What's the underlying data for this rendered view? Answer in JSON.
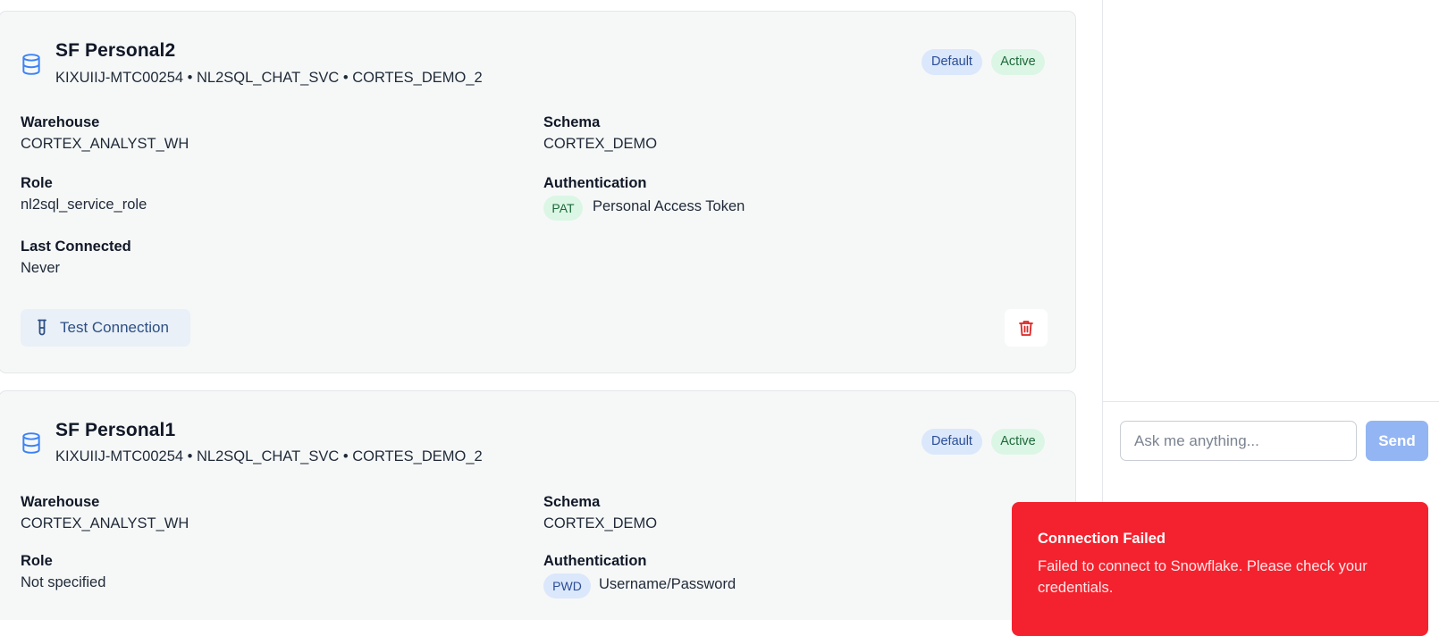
{
  "connections": [
    {
      "name": "SF Personal2",
      "subtitle": "KIXUIIJ-MTC00254 • NL2SQL_CHAT_SVC • CORTES_DEMO_2",
      "badges": {
        "default": "Default",
        "active": "Active"
      },
      "warehouse_label": "Warehouse",
      "warehouse": "CORTEX_ANALYST_WH",
      "schema_label": "Schema",
      "schema": "CORTEX_DEMO",
      "role_label": "Role",
      "role": "nl2sql_service_role",
      "auth_label": "Authentication",
      "auth_tag": "PAT",
      "auth_text": "Personal Access Token",
      "last_connected_label": "Last Connected",
      "last_connected": "Never",
      "test_button": "Test Connection"
    },
    {
      "name": "SF Personal1",
      "subtitle": "KIXUIIJ-MTC00254 • NL2SQL_CHAT_SVC • CORTES_DEMO_2",
      "badges": {
        "default": "Default",
        "active": "Active"
      },
      "warehouse_label": "Warehouse",
      "warehouse": "CORTEX_ANALYST_WH",
      "schema_label": "Schema",
      "schema": "CORTEX_DEMO",
      "role_label": "Role",
      "role": "Not specified",
      "auth_label": "Authentication",
      "auth_tag": "PWD",
      "auth_text": "Username/Password"
    }
  ],
  "chat": {
    "placeholder": "Ask me anything...",
    "send_label": "Send"
  },
  "toast": {
    "title": "Connection Failed",
    "message": "Failed to connect to Snowflake. Please check your credentials."
  },
  "colors": {
    "accent_blue": "#3b82f6",
    "danger_red": "#f4222e",
    "delete_icon": "#dc2626",
    "send_disabled": "#93b5f3"
  },
  "icons": [
    "database-icon",
    "test-tube-icon",
    "trash-icon"
  ]
}
